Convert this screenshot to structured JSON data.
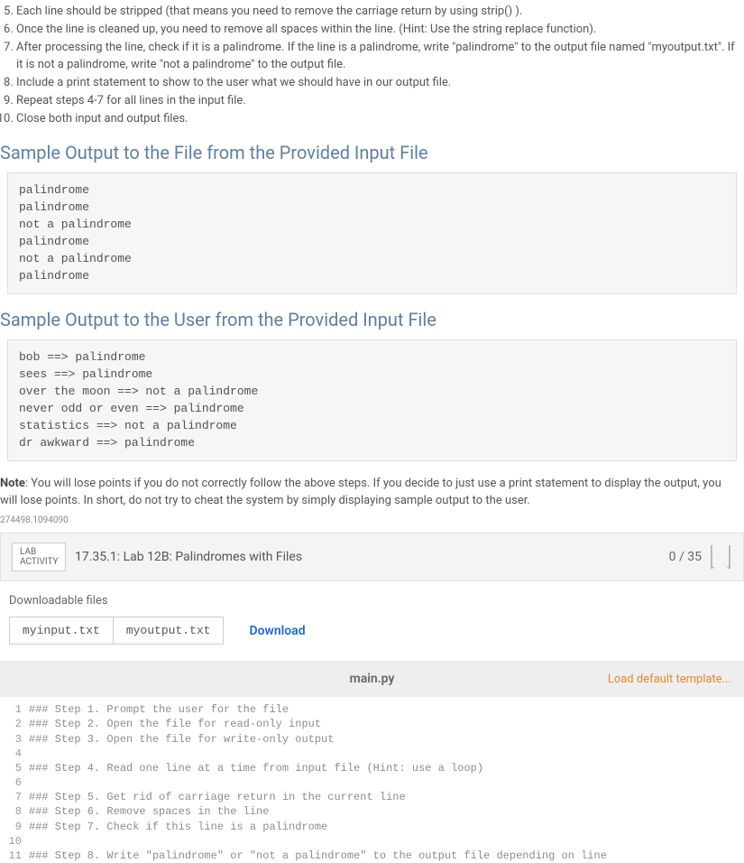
{
  "steps": [
    "Each line should be stripped (that means you need to remove the carriage return by using strip() ).",
    "Once the line is cleaned up, you need to remove all spaces within the line. (Hint: Use the string replace function).",
    "After processing the line, check if it is a palindrome. If the line is a palindrome, write \"palindrome\" to the output file named \"myoutput.txt\". If it is not a palindrome, write \"not a palindrome\" to the output file.",
    "Include a print statement to show to the user what we should have in our output file.",
    "Repeat steps 4-7 for all lines in the input file.",
    "Close both input and output files."
  ],
  "step_start": 5,
  "section1": "Sample Output to the File from the Provided Input File",
  "sample_file": "palindrome\npalindrome\nnot a palindrome\npalindrome\nnot a palindrome\npalindrome",
  "section2": "Sample Output to the User from the Provided Input File",
  "sample_user": "bob ==> palindrome\nsees ==> palindrome\nover the moon ==> not a palindrome\nnever odd or even ==> palindrome\nstatistics ==> not a palindrome\ndr awkward ==> palindrome",
  "note_label": "Note",
  "note_text": ": You will lose points if you do not correctly follow the above steps. If you decide to just use a print statement to display the output, you will lose points. In short, do not try to cheat the system by simply displaying sample output to the user.",
  "tiny_id": "274498.1094090",
  "lab": {
    "tag_line1": "LAB",
    "tag_line2": "ACTIVITY",
    "title": "17.35.1: Lab 12B: Palindromes with Files",
    "score": "0 / 35"
  },
  "downloads": {
    "label": "Downloadable files",
    "files": [
      "myinput.txt",
      "myoutput.txt"
    ],
    "link": "Download"
  },
  "editor": {
    "filename": "main.py",
    "load_template": "Load default template...",
    "lines": [
      "### Step 1. Prompt the user for the file",
      "### Step 2. Open the file for read-only input",
      "### Step 3. Open the file for write-only output",
      "",
      "### Step 4. Read one line at a time from input file (Hint: use a loop)",
      "",
      "### Step 5. Get rid of carriage return in the current line",
      "### Step 6. Remove spaces in the line",
      "### Step 7. Check if this line is a palindrome",
      "",
      "### Step 8. Write \"palindrome\" or \"not a palindrome\" to the output file depending on line"
    ]
  }
}
